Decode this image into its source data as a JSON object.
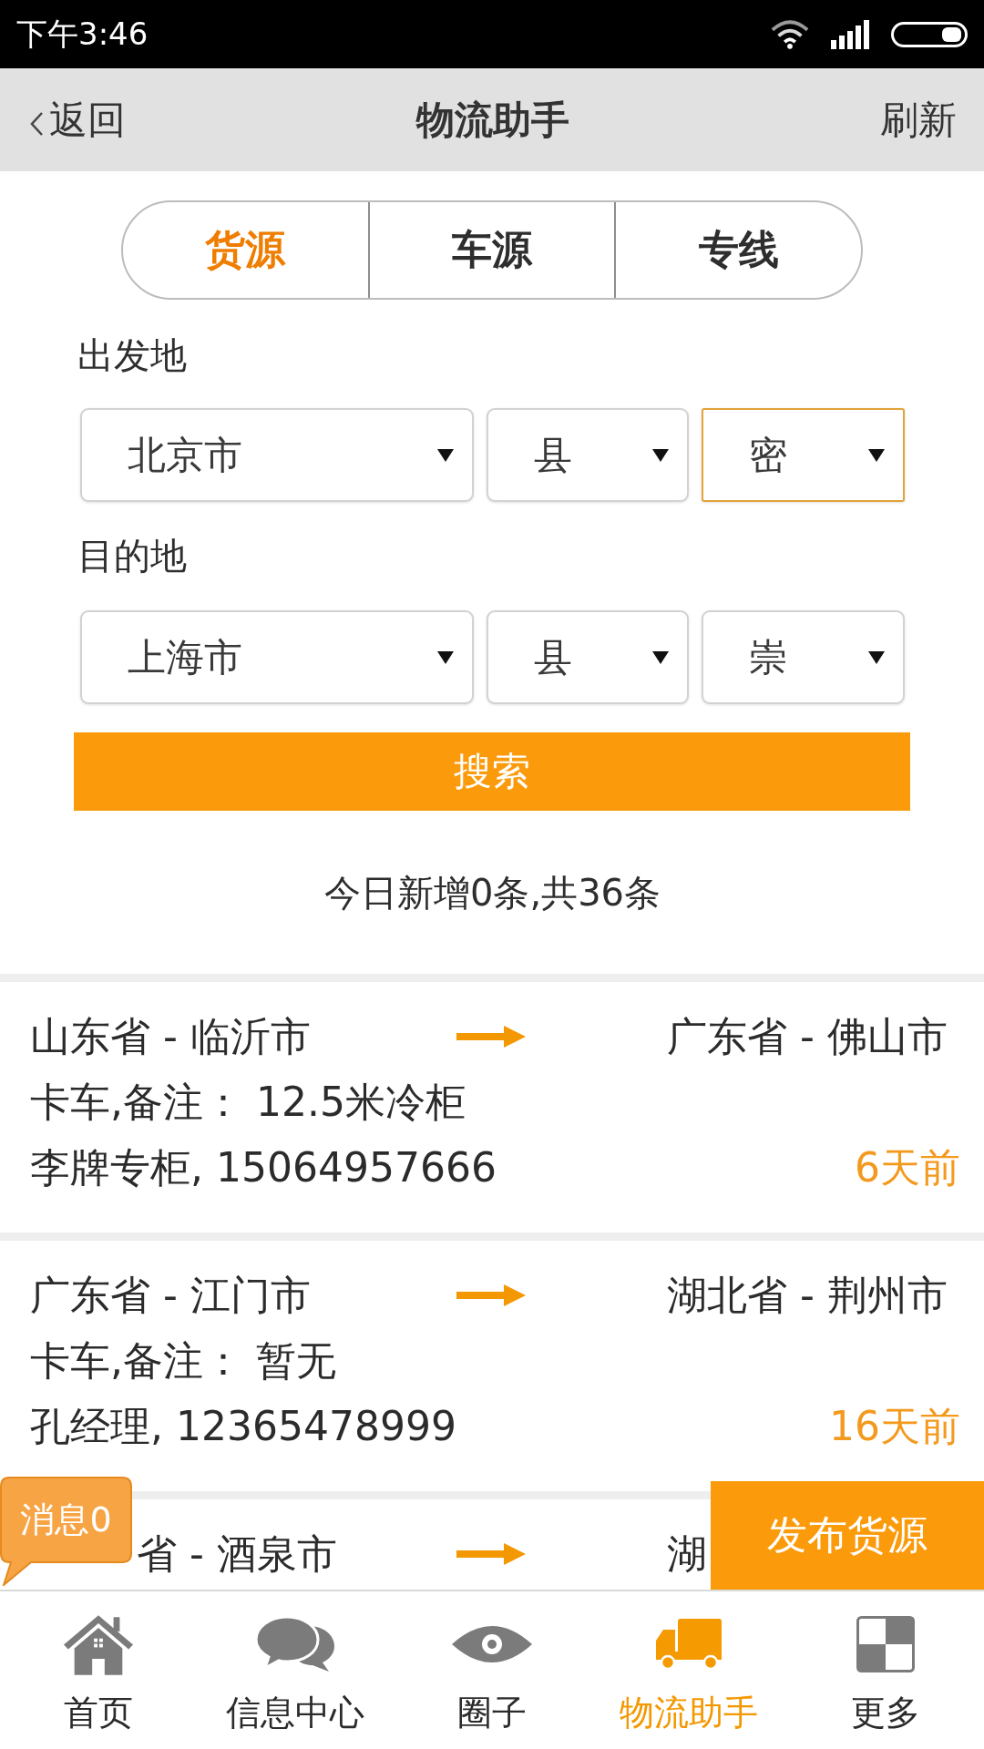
{
  "status_bar": {
    "time": "下午3:46"
  },
  "header": {
    "back": "返回",
    "title": "物流助手",
    "refresh": "刷新"
  },
  "tabs": [
    {
      "label": "货源",
      "selected": true
    },
    {
      "label": "车源",
      "selected": false
    },
    {
      "label": "专线",
      "selected": false
    }
  ],
  "origin": {
    "label": "出发地",
    "selects": [
      {
        "value": "北京市",
        "focused": false
      },
      {
        "value": "县",
        "focused": false
      },
      {
        "value": "密",
        "focused": true
      }
    ]
  },
  "destination": {
    "label": "目的地",
    "selects": [
      {
        "value": "上海市",
        "focused": false
      },
      {
        "value": "县",
        "focused": false
      },
      {
        "value": "崇",
        "focused": false
      }
    ]
  },
  "search_button": "搜索",
  "summary": "今日新增0条,共36条",
  "listings": [
    {
      "from": "山东省 - 临沂市",
      "to": "广东省 - 佛山市",
      "detail": "卡车,备注： 12.5米冷柜",
      "contact": "李牌专柜, 15064957666",
      "time": "6天前"
    },
    {
      "from": "广东省 - 江门市",
      "to": "湖北省 - 荆州市",
      "detail": "卡车,备注： 暂无",
      "contact": "孔经理, 12365478999",
      "time": "16天前"
    },
    {
      "from": "省 - 酒泉市",
      "to": "湖"
    }
  ],
  "message_badge": "消息0",
  "publish_button": "发布货源",
  "bottom_nav": [
    {
      "label": "首页",
      "selected": false
    },
    {
      "label": "信息中心",
      "selected": false
    },
    {
      "label": "圈子",
      "selected": false
    },
    {
      "label": "物流助手",
      "selected": true
    },
    {
      "label": "更多",
      "selected": false
    }
  ]
}
